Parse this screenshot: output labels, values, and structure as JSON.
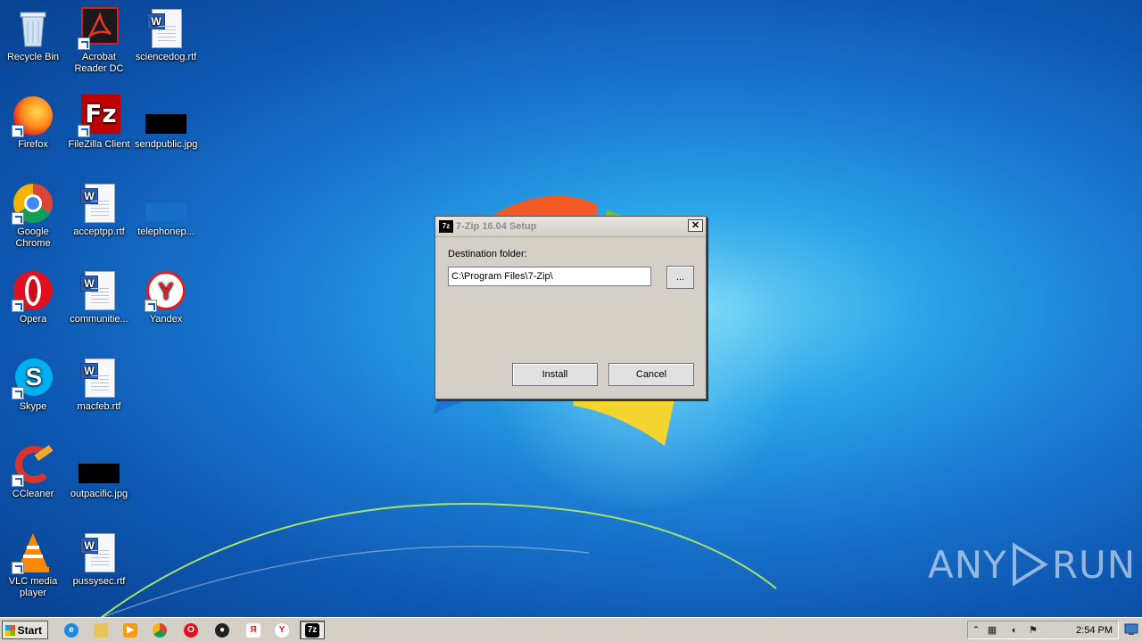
{
  "desktop": {
    "icons": [
      {
        "id": "recycle-bin",
        "label": "Recycle Bin"
      },
      {
        "id": "acrobat",
        "label": "Acrobat Reader DC"
      },
      {
        "id": "sciencedog",
        "label": "sciencedog.rtf"
      },
      {
        "id": "firefox",
        "label": "Firefox"
      },
      {
        "id": "filezilla",
        "label": "FileZilla Client"
      },
      {
        "id": "sendpublic",
        "label": "sendpublic.jpg"
      },
      {
        "id": "chrome",
        "label": "Google Chrome"
      },
      {
        "id": "acceptpp",
        "label": "acceptpp.rtf"
      },
      {
        "id": "telephonep",
        "label": "telephonep..."
      },
      {
        "id": "opera",
        "label": "Opera"
      },
      {
        "id": "communitie",
        "label": "communitie..."
      },
      {
        "id": "yandex",
        "label": "Yandex"
      },
      {
        "id": "skype",
        "label": "Skype"
      },
      {
        "id": "macfeb",
        "label": "macfeb.rtf"
      },
      {
        "id": "ccleaner",
        "label": "CCleaner"
      },
      {
        "id": "outpacific",
        "label": "outpacific.jpg"
      },
      {
        "id": "vlc",
        "label": "VLC media player"
      },
      {
        "id": "pussysec",
        "label": "pussysec.rtf"
      }
    ]
  },
  "dialog": {
    "title": "7-Zip 16.04 Setup",
    "app_icon_text": "7z",
    "close_label": "✕",
    "destination_label": "Destination folder:",
    "destination_value": "C:\\Program Files\\7-Zip\\",
    "browse_label": "...",
    "install_label": "Install",
    "cancel_label": "Cancel"
  },
  "taskbar": {
    "start_label": "Start",
    "clock": "2:54 PM",
    "tray_expand": "⌃"
  },
  "watermark": {
    "left": "ANY",
    "right": "RUN"
  }
}
